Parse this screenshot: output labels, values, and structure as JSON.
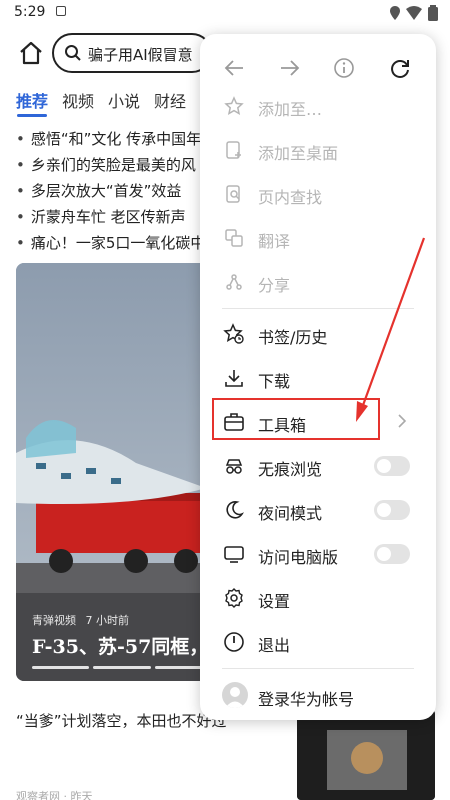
{
  "status_bar": {
    "time": "5:29"
  },
  "address_bar": {
    "search_text": "骗子用AI假冒意"
  },
  "tabs": [
    {
      "label": "推荐"
    },
    {
      "label": "视频"
    },
    {
      "label": "小说"
    },
    {
      "label": "财经"
    }
  ],
  "headlines": [
    "感悟“和”文化 传承中国年",
    "乡亲们的笑脸是最美的风",
    "多层次放大“首发”效益",
    "沂蒙舟车忙 老区传新声",
    "痛心！一家5口一氧化碳中"
  ],
  "video_card": {
    "source": "青弹视频",
    "time": "7 小时前",
    "title": "F-35、苏-57同框，美"
  },
  "article": {
    "title": "“当爹”计划落空，本田也不好过",
    "source": "观察者网 · 昨天"
  },
  "menu": {
    "items": [
      {
        "label": "添加至…",
        "enabled": false
      },
      {
        "label": "添加至桌面",
        "enabled": false
      },
      {
        "label": "页内查找",
        "enabled": false
      },
      {
        "label": "翻译",
        "enabled": false
      },
      {
        "label": "分享",
        "enabled": false
      },
      {
        "label": "书签/历史",
        "enabled": true
      },
      {
        "label": "下载",
        "enabled": true
      },
      {
        "label": "工具箱",
        "enabled": true,
        "submenu": true,
        "highlighted": true
      },
      {
        "label": "无痕浏览",
        "enabled": true,
        "toggle": false
      },
      {
        "label": "夜间模式",
        "enabled": true,
        "toggle": false
      },
      {
        "label": "访问电脑版",
        "enabled": true,
        "toggle": false
      },
      {
        "label": "设置",
        "enabled": true
      },
      {
        "label": "退出",
        "enabled": true
      }
    ],
    "account_label": "登录华为帐号"
  },
  "colors": {
    "accent": "#2f66d8",
    "annotation_red": "#e5322d"
  }
}
